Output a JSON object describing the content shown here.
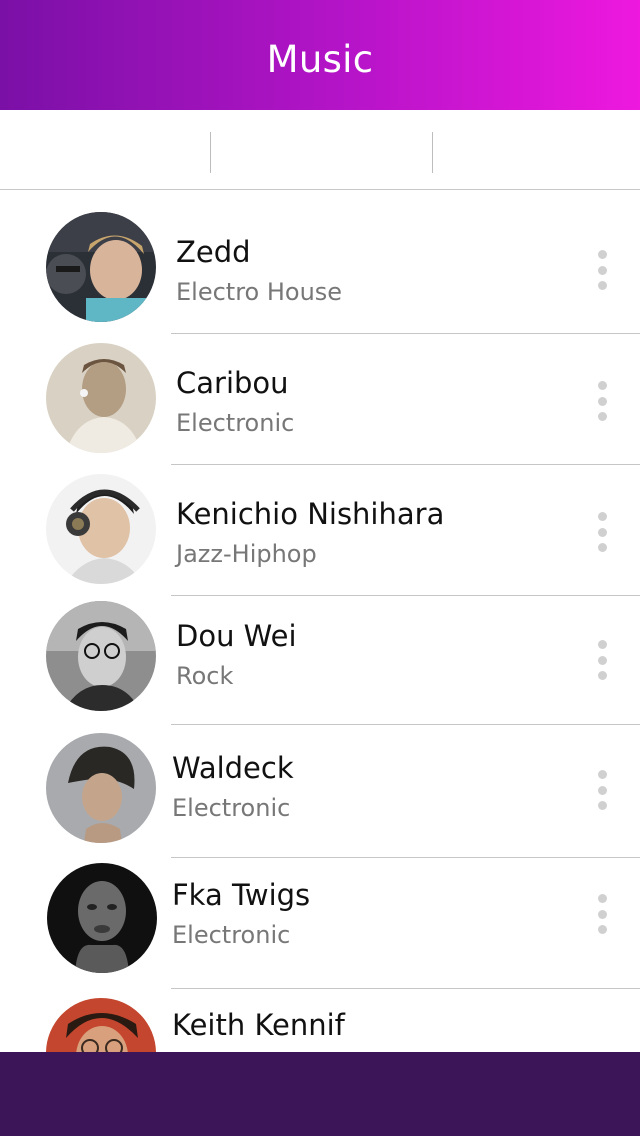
{
  "header": {
    "title": "Music"
  },
  "segments": [
    {
      "label": ""
    },
    {
      "label": ""
    },
    {
      "label": ""
    }
  ],
  "artists": [
    {
      "name": "Zedd",
      "genre": "Electro House"
    },
    {
      "name": "Caribou",
      "genre": "Electronic"
    },
    {
      "name": "Kenichio Nishihara",
      "genre": "Jazz-Hiphop"
    },
    {
      "name": "Dou Wei",
      "genre": "Rock"
    },
    {
      "name": "Waldeck",
      "genre": "Electronic"
    },
    {
      "name": "Fka Twigs",
      "genre": "Electronic"
    },
    {
      "name": "Keith Kennif",
      "genre": ""
    }
  ],
  "colors": {
    "header_gradient_start": "#7a10a6",
    "header_gradient_end": "#ee18de",
    "bottom_bar": "#3b1557"
  },
  "icons": {
    "more": "more-vertical-icon",
    "avatar": "artist-photo"
  }
}
